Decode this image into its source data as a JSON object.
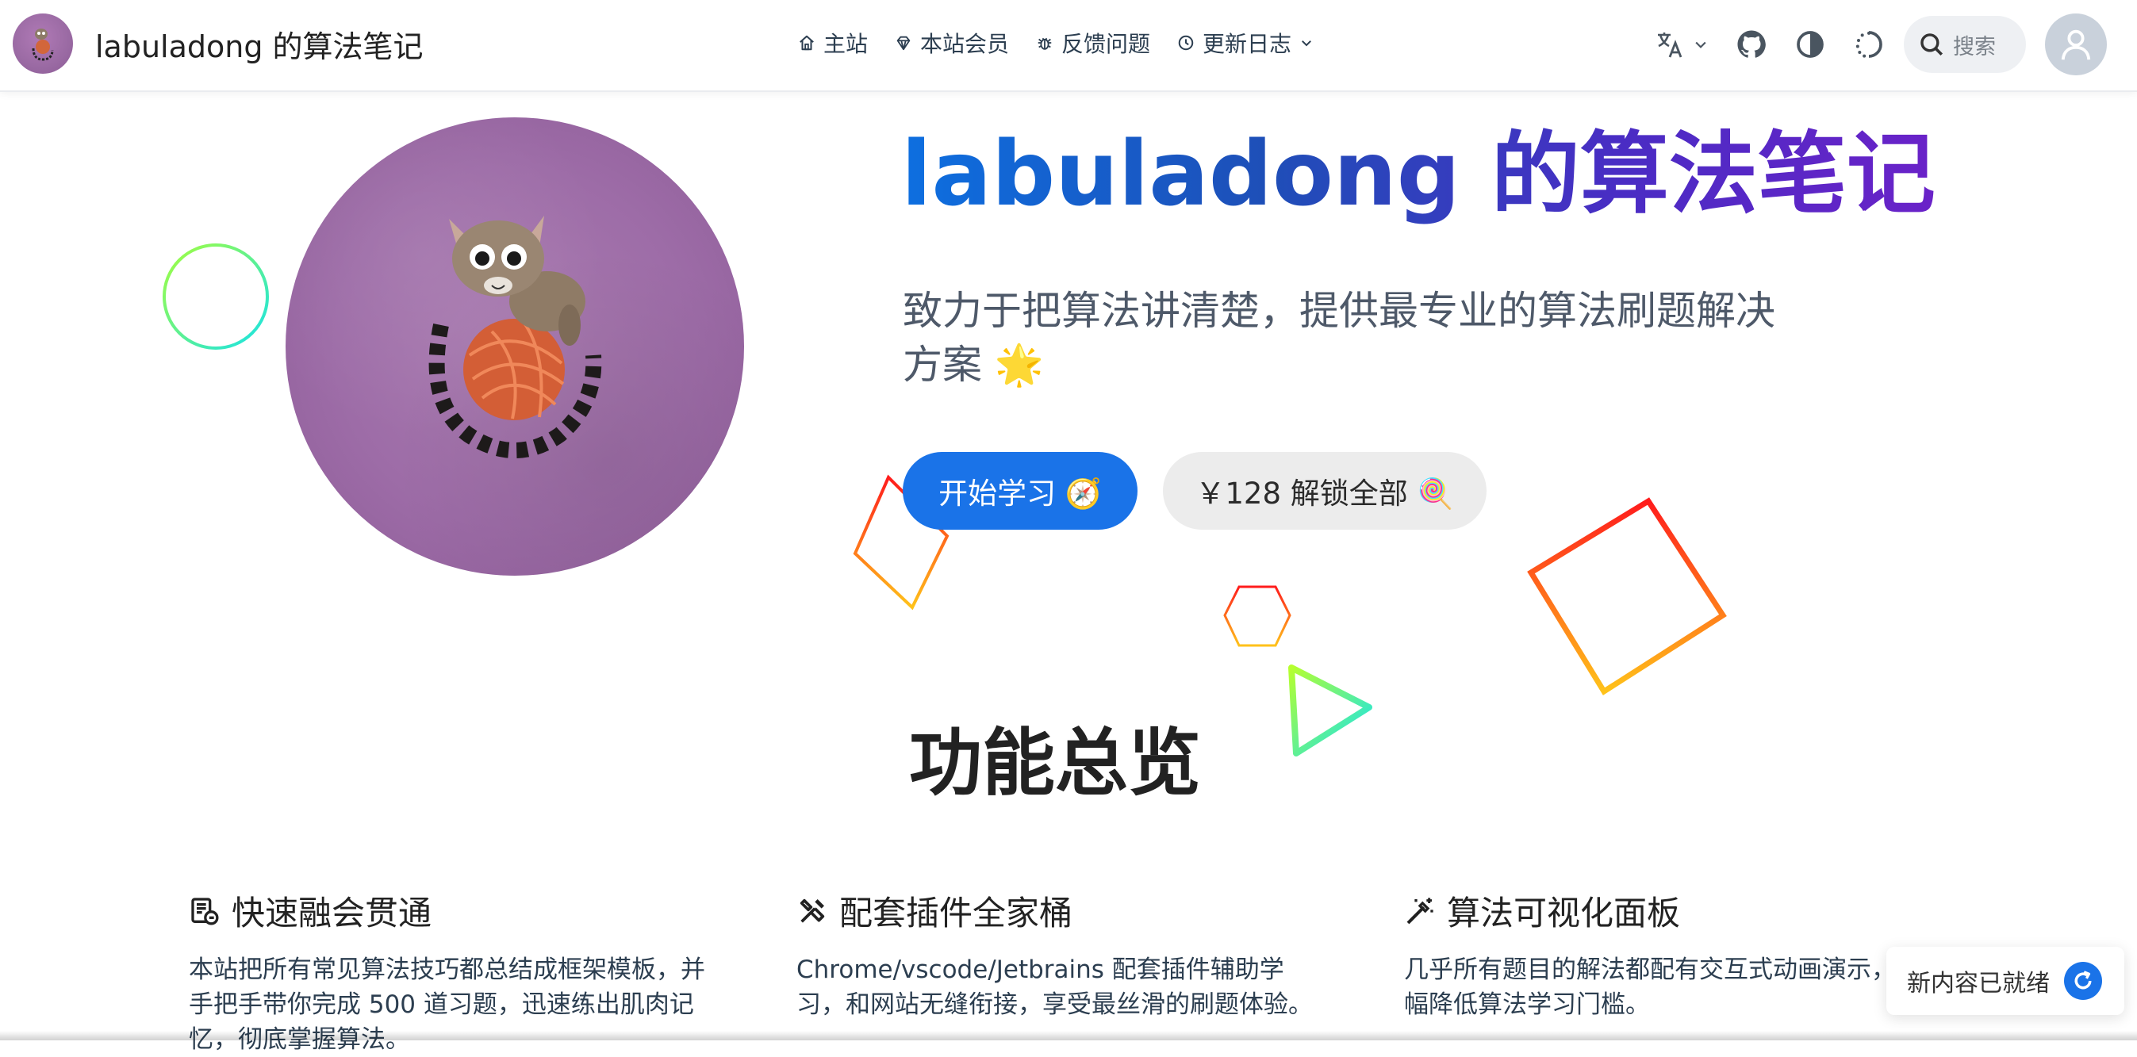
{
  "navbar": {
    "site_title": "labuladong 的算法笔记",
    "links": [
      {
        "label": "主站",
        "icon": "home-icon"
      },
      {
        "label": "本站会员",
        "icon": "gem-icon"
      },
      {
        "label": "反馈问题",
        "icon": "bug-icon"
      },
      {
        "label": "更新日志",
        "icon": "clock-icon"
      }
    ],
    "search_placeholder": "搜索"
  },
  "hero": {
    "title": "labuladong 的算法笔记",
    "description": "致力于把算法讲清楚，提供最专业的算法刷题解决方案 🌟",
    "primary_button": "开始学习 🧭",
    "secondary_button": "￥128 解锁全部 🍭"
  },
  "features": {
    "section_title": "功能总览",
    "items": [
      {
        "title": "快速融会贯通",
        "text": "本站把所有常见算法技巧都总结成框架模板，并手把手带你完成 500 道习题，迅速练出肌肉记忆，彻底掌握算法。"
      },
      {
        "title": "配套插件全家桶",
        "text": "Chrome/vscode/Jetbrains 配套插件辅助学习，和网站无缝衔接，享受最丝滑的刷题体验。"
      },
      {
        "title": "算法可视化面板",
        "text": "几乎所有题目的解法都配有交互式动画演示，大幅降低算法学习门槛。"
      }
    ]
  },
  "toast": {
    "text": "新内容已就绪"
  },
  "colors": {
    "accent": "#1a73e8",
    "title_gradient_start": "#0d6fe0",
    "title_gradient_end": "#6a22c8"
  }
}
